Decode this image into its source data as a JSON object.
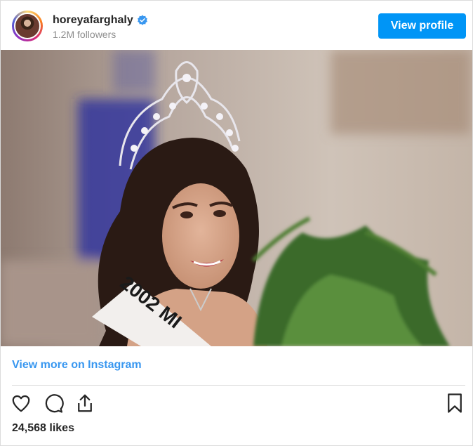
{
  "header": {
    "username": "horeyafarghaly",
    "followers": "1.2M followers",
    "view_profile_label": "View profile"
  },
  "photo": {
    "sash_text": "2002 MI"
  },
  "view_more_label": "View more on Instagram",
  "actions": {
    "icons": [
      "heart-icon",
      "comment-icon",
      "share-icon",
      "bookmark-icon"
    ]
  },
  "likes": "24,568 likes",
  "colors": {
    "button_blue": "#0095f6",
    "link_blue": "#3897f0",
    "verified_blue": "#3897f0"
  }
}
